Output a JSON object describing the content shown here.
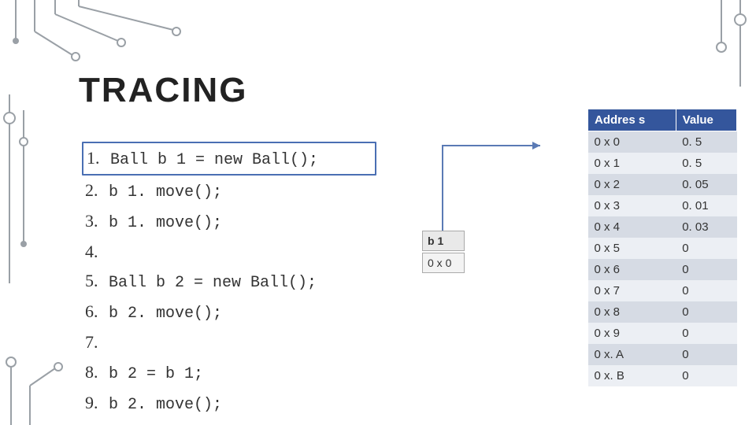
{
  "title": "TRACING",
  "code": [
    {
      "n": "1.",
      "s": "Ball b 1 = new Ball();",
      "hl": true
    },
    {
      "n": "2.",
      "s": "b 1. move();",
      "hl": false
    },
    {
      "n": "3.",
      "s": "b 1. move();",
      "hl": false
    },
    {
      "n": "4.",
      "s": "",
      "hl": false
    },
    {
      "n": "5.",
      "s": "Ball b 2 = new Ball();",
      "hl": false
    },
    {
      "n": "6.",
      "s": "b 2. move();",
      "hl": false
    },
    {
      "n": "7.",
      "s": "",
      "hl": false
    },
    {
      "n": "8.",
      "s": "b 2 = b 1;",
      "hl": false
    },
    {
      "n": "9.",
      "s": "b 2. move();",
      "hl": false
    }
  ],
  "pointer": {
    "label": "b 1",
    "value": "0 x 0"
  },
  "memory": {
    "headers": {
      "addr": "Addres s",
      "val": "Value"
    },
    "rows": [
      {
        "addr": "0 x 0",
        "val": "0. 5"
      },
      {
        "addr": "0 x 1",
        "val": "0. 5"
      },
      {
        "addr": "0 x 2",
        "val": "0. 05"
      },
      {
        "addr": "0 x 3",
        "val": "0. 01"
      },
      {
        "addr": "0 x 4",
        "val": "0. 03"
      },
      {
        "addr": "0 x 5",
        "val": "0"
      },
      {
        "addr": "0 x 6",
        "val": "0"
      },
      {
        "addr": "0 x 7",
        "val": "0"
      },
      {
        "addr": "0 x 8",
        "val": "0"
      },
      {
        "addr": "0 x 9",
        "val": "0"
      },
      {
        "addr": "0 x. A",
        "val": "0"
      },
      {
        "addr": "0 x. B",
        "val": "0"
      }
    ]
  }
}
